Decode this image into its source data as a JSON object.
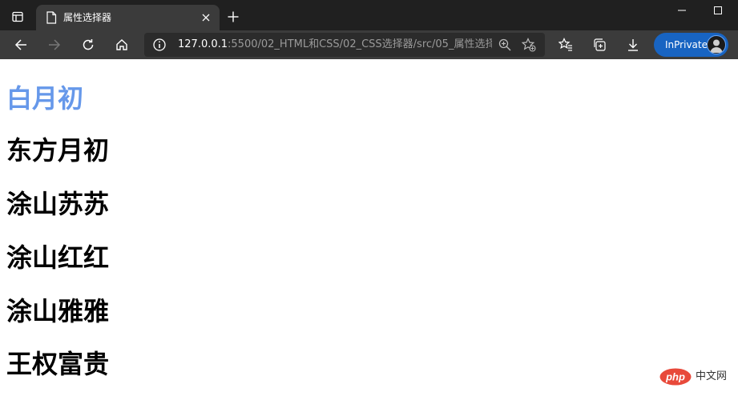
{
  "browser": {
    "tab": {
      "title": "属性选择器"
    },
    "url": {
      "host": "127.0.0.1",
      "rest": ":5500/02_HTML和CSS/02_CSS选择器/src/05_属性选择..."
    },
    "inprivate_label": "InPrivate"
  },
  "page": {
    "headings": [
      "白月初",
      "东方月初",
      "涂山苏苏",
      "涂山红红",
      "涂山雅雅",
      "王权富贵"
    ],
    "highlight_color": "#6698ea",
    "text_color": "#000000"
  },
  "watermark": {
    "logo_text": "php",
    "text": "中文网"
  },
  "icons": [
    "tab-actions-icon",
    "page-icon",
    "close-icon",
    "plus-icon",
    "minimize-icon",
    "maximize-icon",
    "back-icon",
    "forward-icon",
    "refresh-icon",
    "home-icon",
    "info-icon",
    "zoom-icon",
    "add-favorite-icon",
    "favorites-icon",
    "collections-icon",
    "download-icon",
    "avatar-icon"
  ]
}
